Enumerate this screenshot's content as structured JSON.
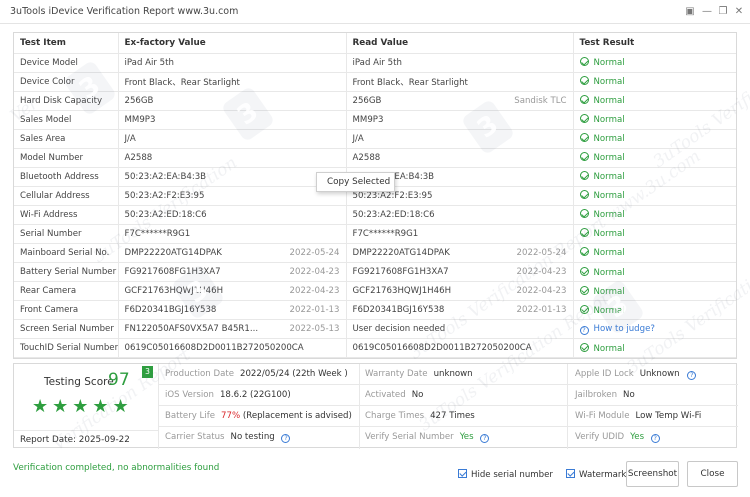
{
  "window": {
    "title": "3uTools iDevice Verification Report www.3u.com"
  },
  "table": {
    "headers": [
      "Test Item",
      "Ex-factory Value",
      "Read Value",
      "Test Result"
    ],
    "rows": [
      {
        "item": "Device Model",
        "ex": "iPad Air 5th",
        "ex_date": "",
        "read": "iPad Air 5th",
        "read_date": "",
        "result": "Normal",
        "result_type": "ok"
      },
      {
        "item": "Device Color",
        "ex": "Front Black、Rear Starlight",
        "ex_date": "",
        "read": "Front Black、Rear Starlight",
        "read_date": "",
        "result": "Normal",
        "result_type": "ok"
      },
      {
        "item": "Hard Disk Capacity",
        "ex": "256GB",
        "ex_date": "",
        "read": "256GB",
        "read_date": "Sandisk TLC",
        "result": "Normal",
        "result_type": "ok"
      },
      {
        "item": "Sales Model",
        "ex": "MM9P3",
        "ex_date": "",
        "read": "MM9P3",
        "read_date": "",
        "result": "Normal",
        "result_type": "ok"
      },
      {
        "item": "Sales Area",
        "ex": "J/A",
        "ex_date": "",
        "read": "J/A",
        "read_date": "",
        "result": "Normal",
        "result_type": "ok"
      },
      {
        "item": "Model Number",
        "ex": "A2588",
        "ex_date": "",
        "read": "A2588",
        "read_date": "",
        "result": "Normal",
        "result_type": "ok"
      },
      {
        "item": "Bluetooth Address",
        "ex": "50:23:A2:EA:B4:3B",
        "ex_date": "",
        "read": "50:23:A2:EA:B4:3B",
        "read_date": "",
        "result": "Normal",
        "result_type": "ok"
      },
      {
        "item": "Cellular Address",
        "ex": "50:23:A2:F2:E3:95",
        "ex_date": "",
        "read": "50:23:A2:F2:E3:95",
        "read_date": "",
        "result": "Normal",
        "result_type": "ok"
      },
      {
        "item": "Wi-Fi Address",
        "ex": "50:23:A2:ED:18:C6",
        "ex_date": "",
        "read": "50:23:A2:ED:18:C6",
        "read_date": "",
        "result": "Normal",
        "result_type": "ok"
      },
      {
        "item": "Serial Number",
        "ex": "F7C******R9G1",
        "ex_date": "",
        "read": "F7C******R9G1",
        "read_date": "",
        "result": "Normal",
        "result_type": "ok"
      },
      {
        "item": "Mainboard Serial No.",
        "ex": "DMP22220ATG14DPAK",
        "ex_date": "2022-05-24",
        "read": "DMP22220ATG14DPAK",
        "read_date": "2022-05-24",
        "result": "Normal",
        "result_type": "ok"
      },
      {
        "item": "Battery Serial Number",
        "ex": "FG9217608FG1H3XA7",
        "ex_date": "2022-04-23",
        "read": "FG9217608FG1H3XA7",
        "read_date": "2022-04-23",
        "result": "Normal",
        "result_type": "ok"
      },
      {
        "item": "Rear Camera",
        "ex": "GCF21763HQWJ1H46H",
        "ex_date": "2022-04-23",
        "read": "GCF21763HQWJ1H46H",
        "read_date": "2022-04-23",
        "result": "Normal",
        "result_type": "ok"
      },
      {
        "item": "Front Camera",
        "ex": "F6D20341BGJ16Y538",
        "ex_date": "2022-01-13",
        "read": "F6D20341BGJ16Y538",
        "read_date": "2022-01-13",
        "result": "Normal",
        "result_type": "ok"
      },
      {
        "item": "Screen Serial Number",
        "ex": "FN122050AFS0VX5A7 B45R1...",
        "ex_date": "2022-05-13",
        "read": "User decision needed",
        "read_date": "",
        "result": "How to judge?",
        "result_type": "question"
      },
      {
        "item": "TouchID Serial Number",
        "ex": "0619C05016608D2D0011B272050200CA",
        "ex_date": "",
        "read": "0619C05016608D2D0011B272050200CA",
        "read_date": "",
        "result": "Normal",
        "result_type": "ok"
      }
    ]
  },
  "context_menu": {
    "item": "Copy Selected"
  },
  "watermark_text": "3uTools Verification Report www.3u.com",
  "score": {
    "label": "Testing Score",
    "value": "97",
    "flag": "3",
    "stars": "★★★★★",
    "report_date_label": "Report Date:",
    "report_date": "2025-09-22"
  },
  "info": {
    "production_date_label": "Production Date",
    "production_date": "2022/05/24 (22th Week )",
    "warranty_date_label": "Warranty Date",
    "warranty_date": "unknown",
    "apple_id_lock_label": "Apple ID Lock",
    "apple_id_lock": "Unknown",
    "ios_version_label": "iOS Version",
    "ios_version": "18.6.2 (22G100)",
    "activated_label": "Activated",
    "activated": "No",
    "jailbroken_label": "Jailbroken",
    "jailbroken": "No",
    "battery_life_label": "Battery Life",
    "battery_life_pct": "77%",
    "battery_life_note": "(Replacement is advised)",
    "charge_times_label": "Charge Times",
    "charge_times": "427 Times",
    "wifi_module_label": "Wi-Fi Module",
    "wifi_module": "Low Temp Wi-Fi",
    "carrier_status_label": "Carrier Status",
    "carrier_status": "No testing",
    "verify_serial_label": "Verify Serial Number",
    "verify_serial": "Yes",
    "verify_udid_label": "Verify UDID",
    "verify_udid": "Yes"
  },
  "footer": {
    "status": "Verification completed, no abnormalities found",
    "hide_serial_label": "Hide serial number",
    "watermarks_label": "Watermarks",
    "screenshot_label": "Screenshot",
    "close_label": "Close"
  },
  "colors": {
    "normal_green": "#2e9e3f",
    "warning_red": "#d9262a",
    "link_blue": "#3a7bd5"
  }
}
